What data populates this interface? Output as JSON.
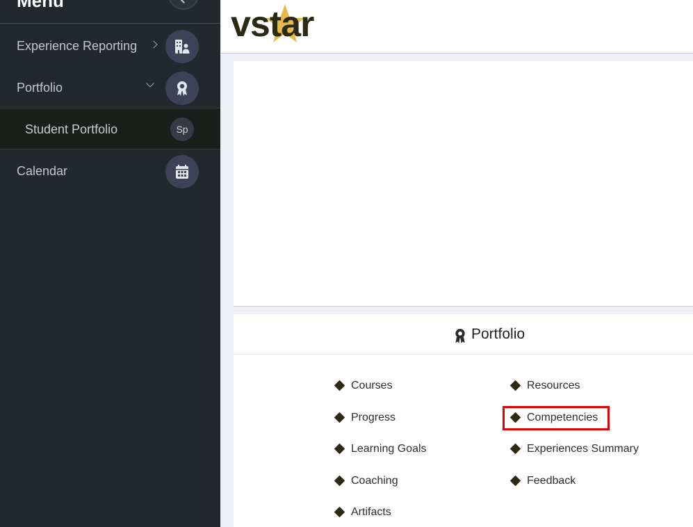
{
  "sidebar": {
    "title": "Menu",
    "items": [
      {
        "label": "Experience Reporting",
        "icon": "building-person-icon"
      },
      {
        "label": "Portfolio",
        "icon": "award-icon"
      },
      {
        "label": "Calendar",
        "icon": "calendar-icon"
      }
    ],
    "sub_item": {
      "label": "Student Portfolio",
      "badge": "Sp"
    }
  },
  "header": {
    "logo": "vstar",
    "logo_color": "#2b2a15",
    "logo_star_color": "#e8b84a"
  },
  "portfolio": {
    "title": "Portfolio",
    "icon": "award-icon",
    "links_left": [
      "Courses",
      "Progress",
      "Learning Goals",
      "Coaching",
      "Artifacts"
    ],
    "links_right": [
      "Resources",
      "Competencies",
      "Experiences Summary",
      "Feedback"
    ],
    "highlighted_link": "Competencies",
    "highlight_color": "#e00000"
  }
}
